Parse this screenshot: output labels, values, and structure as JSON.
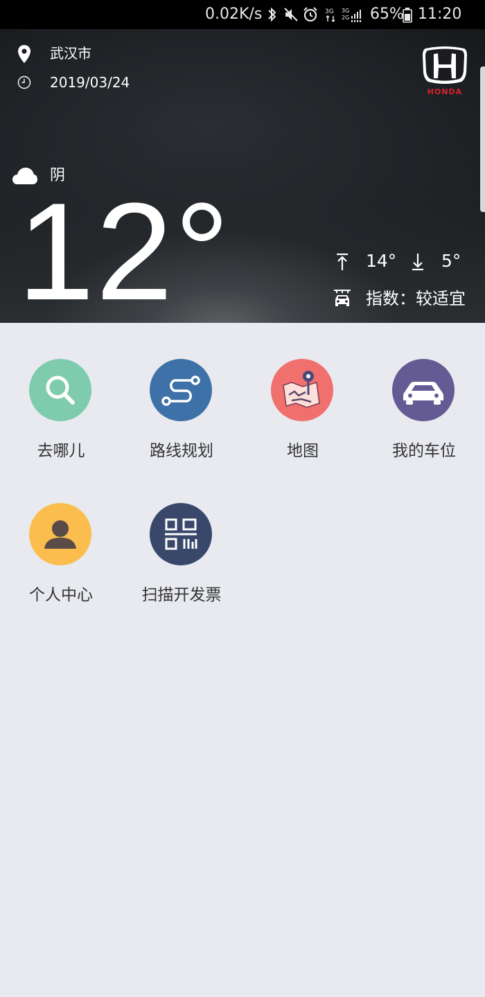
{
  "status_bar": {
    "net_speed": "0.02K/s",
    "network_3g": "3G",
    "network_3g2g": "3G 2G",
    "battery_percent": "65%",
    "time": "11:20"
  },
  "header": {
    "location": "武汉市",
    "date": "2019/03/24",
    "brand_logo_text": "HONDA",
    "weather": {
      "condition": "阴",
      "temperature": "12°",
      "high": "14°",
      "low": "5°",
      "car_wash_index": "指数：较适宜"
    }
  },
  "apps": [
    {
      "label": "去哪儿",
      "icon": "search-icon",
      "color": "#7ecbae"
    },
    {
      "label": "路线规划",
      "icon": "route-icon",
      "color": "#3e71a8"
    },
    {
      "label": "地图",
      "icon": "map-icon",
      "color": "#f0706e"
    },
    {
      "label": "我的车位",
      "icon": "car-icon",
      "color": "#655b94"
    },
    {
      "label": "个人中心",
      "icon": "person-icon",
      "color": "#fbbe4e"
    },
    {
      "label": "扫描开发票",
      "icon": "qr-scan-icon",
      "color": "#38476a"
    }
  ]
}
